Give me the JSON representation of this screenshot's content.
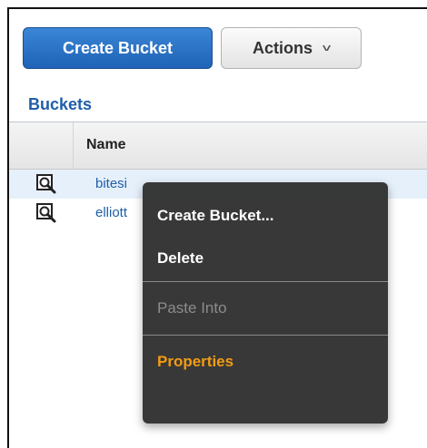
{
  "toolbar": {
    "create_label": "Create Bucket",
    "actions_label": "Actions",
    "actions_caret": "˅"
  },
  "section": {
    "title": "Buckets"
  },
  "table": {
    "columns": [
      "Name"
    ],
    "rows": [
      {
        "name": "bitesi",
        "selected": true,
        "icon": "magnifier-bucket-icon"
      },
      {
        "name": "elliott",
        "selected": false,
        "icon": "magnifier-bucket-icon"
      }
    ]
  },
  "context_menu": {
    "items": [
      {
        "label": "Create Bucket...",
        "state": "enabled"
      },
      {
        "label": "Delete",
        "state": "enabled"
      },
      {
        "label": "Paste Into",
        "state": "disabled"
      },
      {
        "label": "Properties",
        "state": "highlighted"
      }
    ]
  },
  "colors": {
    "primary_button": "#1e63b6",
    "link_blue": "#1f5fa8",
    "menu_background": "#303030",
    "menu_highlight": "#f39c12"
  }
}
